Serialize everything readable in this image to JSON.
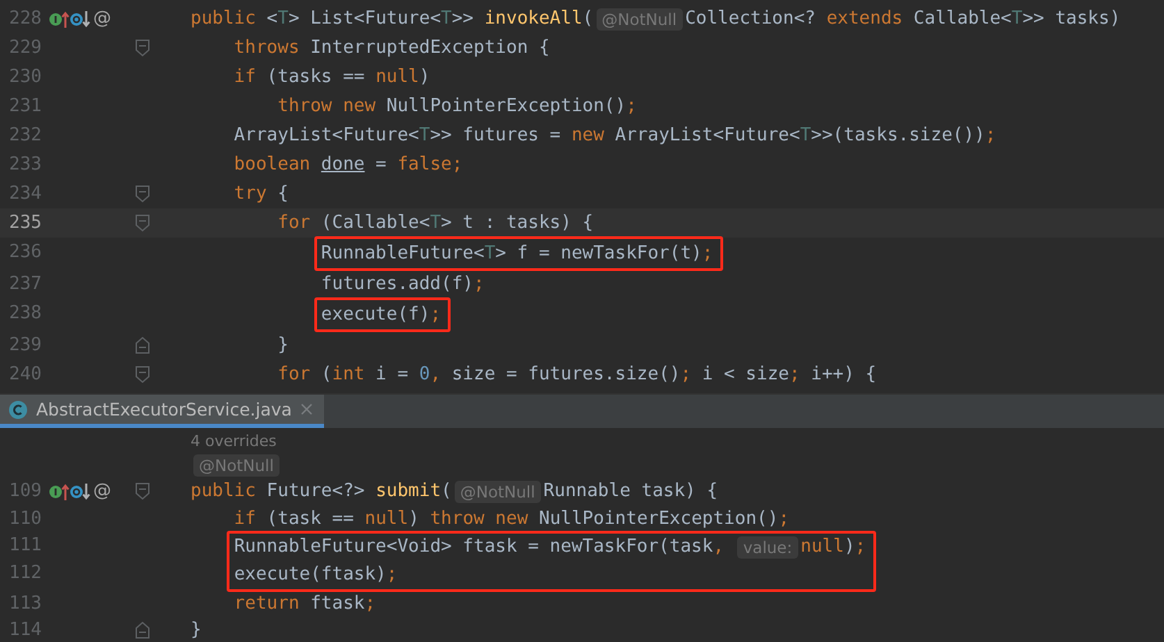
{
  "editor_top": {
    "lines": [
      {
        "number": "228",
        "gutter_mark": "@",
        "current": false,
        "boxed": false,
        "fold_start": false,
        "fold_end": false,
        "tokens": [
          {
            "text": "public",
            "kind": "keyword"
          },
          {
            "text": " <",
            "kind": "plain"
          },
          {
            "text": "T",
            "kind": "type_param"
          },
          {
            "text": "> List<Future<",
            "kind": "plain"
          },
          {
            "text": "T",
            "kind": "type_param"
          },
          {
            "text": ">> ",
            "kind": "plain"
          },
          {
            "text": "invokeAll",
            "kind": "method"
          },
          {
            "text": "(",
            "kind": "plain"
          },
          {
            "text": "@NotNull",
            "kind": "inlay"
          },
          {
            "text": "Collection<? ",
            "kind": "plain"
          },
          {
            "text": "extends",
            "kind": "keyword"
          },
          {
            "text": " Callable<",
            "kind": "plain"
          },
          {
            "text": "T",
            "kind": "type_param"
          },
          {
            "text": ">> tasks)",
            "kind": "plain"
          }
        ]
      },
      {
        "number": "229",
        "current": false,
        "boxed": false,
        "fold_start": true,
        "fold_end": false,
        "tokens": [
          {
            "text": "    throws",
            "kind": "keyword"
          },
          {
            "text": " InterruptedException {",
            "kind": "plain"
          }
        ]
      },
      {
        "number": "230",
        "current": false,
        "boxed": false,
        "fold_start": false,
        "fold_end": false,
        "tokens": [
          {
            "text": "    if",
            "kind": "keyword"
          },
          {
            "text": " (tasks == ",
            "kind": "plain"
          },
          {
            "text": "null",
            "kind": "keyword"
          },
          {
            "text": ")",
            "kind": "plain"
          }
        ]
      },
      {
        "number": "231",
        "current": false,
        "boxed": false,
        "fold_start": false,
        "fold_end": false,
        "tokens": [
          {
            "text": "        throw new",
            "kind": "keyword"
          },
          {
            "text": " NullPointerException()",
            "kind": "plain"
          },
          {
            "text": ";",
            "kind": "keyword"
          }
        ]
      },
      {
        "number": "232",
        "current": false,
        "boxed": false,
        "fold_start": false,
        "fold_end": false,
        "tokens": [
          {
            "text": "    ArrayList<Future<",
            "kind": "plain"
          },
          {
            "text": "T",
            "kind": "type_param"
          },
          {
            "text": ">> futures = ",
            "kind": "plain"
          },
          {
            "text": "new",
            "kind": "keyword"
          },
          {
            "text": " ArrayList<Future<",
            "kind": "plain"
          },
          {
            "text": "T",
            "kind": "type_param"
          },
          {
            "text": ">>(tasks.size())",
            "kind": "plain"
          },
          {
            "text": ";",
            "kind": "keyword"
          }
        ]
      },
      {
        "number": "233",
        "current": false,
        "boxed": false,
        "fold_start": false,
        "fold_end": false,
        "tokens": [
          {
            "text": "    boolean ",
            "kind": "keyword"
          },
          {
            "text": "done",
            "kind": "local_var"
          },
          {
            "text": " = ",
            "kind": "plain"
          },
          {
            "text": "false;",
            "kind": "keyword"
          }
        ]
      },
      {
        "number": "234",
        "current": false,
        "boxed": false,
        "fold_start": true,
        "fold_end": false,
        "tokens": [
          {
            "text": "    try",
            "kind": "keyword"
          },
          {
            "text": " {",
            "kind": "plain"
          }
        ]
      },
      {
        "number": "235",
        "current": true,
        "boxed": false,
        "fold_start": true,
        "fold_end": false,
        "tokens": [
          {
            "text": "        for",
            "kind": "keyword"
          },
          {
            "text": " (Callable<",
            "kind": "plain"
          },
          {
            "text": "T",
            "kind": "type_param"
          },
          {
            "text": "> t : tasks) {",
            "kind": "plain"
          }
        ]
      },
      {
        "number": "236",
        "current": false,
        "boxed": true,
        "fold_start": false,
        "fold_end": false,
        "tokens": [
          {
            "text": "            RunnableFuture<",
            "kind": "plain"
          },
          {
            "text": "T",
            "kind": "type_param"
          },
          {
            "text": "> f = newTaskFor(t)",
            "kind": "plain"
          },
          {
            "text": ";",
            "kind": "keyword"
          }
        ]
      },
      {
        "number": "237",
        "current": false,
        "boxed": false,
        "fold_start": false,
        "fold_end": false,
        "tokens": [
          {
            "text": "            futures.add(f)",
            "kind": "plain"
          },
          {
            "text": ";",
            "kind": "keyword"
          }
        ]
      },
      {
        "number": "238",
        "current": false,
        "boxed": true,
        "fold_start": false,
        "fold_end": false,
        "tokens": [
          {
            "text": "            execute(f)",
            "kind": "plain"
          },
          {
            "text": ";",
            "kind": "keyword"
          }
        ]
      },
      {
        "number": "239",
        "current": false,
        "boxed": false,
        "fold_start": false,
        "fold_end": true,
        "tokens": [
          {
            "text": "        }",
            "kind": "plain"
          }
        ]
      },
      {
        "number": "240",
        "current": false,
        "boxed": false,
        "fold_start": true,
        "fold_end": false,
        "tokens": [
          {
            "text": "        for",
            "kind": "keyword"
          },
          {
            "text": " (",
            "kind": "plain"
          },
          {
            "text": "int",
            "kind": "keyword"
          },
          {
            "text": " i = ",
            "kind": "plain"
          },
          {
            "text": "0",
            "kind": "number"
          },
          {
            "text": ",",
            "kind": "keyword"
          },
          {
            "text": " size = futures.size()",
            "kind": "plain"
          },
          {
            "text": ";",
            "kind": "keyword"
          },
          {
            "text": " i < size",
            "kind": "plain"
          },
          {
            "text": ";",
            "kind": "keyword"
          },
          {
            "text": " i++) {",
            "kind": "plain"
          }
        ]
      }
    ]
  },
  "tab_bar": {
    "tabs": [
      {
        "label": "AbstractExecutorService.java",
        "selected": true
      }
    ]
  },
  "editor_bottom": {
    "lines": [
      {
        "current": false,
        "boxed": false,
        "fold_start": false,
        "fold_end": false,
        "tokens": [
          {
            "text": "4 overrides",
            "kind": "hint"
          }
        ]
      },
      {
        "current": false,
        "boxed": false,
        "fold_start": false,
        "fold_end": false,
        "tokens": [
          {
            "text": "@NotNull",
            "kind": "inlay"
          }
        ]
      },
      {
        "number": "109",
        "gutter_mark": "@",
        "current": false,
        "boxed": false,
        "fold_start": true,
        "fold_end": false,
        "tokens": [
          {
            "text": "public",
            "kind": "keyword"
          },
          {
            "text": " Future<?> ",
            "kind": "plain"
          },
          {
            "text": "submit",
            "kind": "method"
          },
          {
            "text": "(",
            "kind": "plain"
          },
          {
            "text": "@NotNull",
            "kind": "inlay"
          },
          {
            "text": "Runnable task) {",
            "kind": "plain"
          }
        ]
      },
      {
        "number": "110",
        "current": false,
        "boxed": false,
        "fold_start": false,
        "fold_end": false,
        "tokens": [
          {
            "text": "    if",
            "kind": "keyword"
          },
          {
            "text": " (task == ",
            "kind": "plain"
          },
          {
            "text": "null",
            "kind": "keyword"
          },
          {
            "text": ") ",
            "kind": "plain"
          },
          {
            "text": "throw new",
            "kind": "keyword"
          },
          {
            "text": " NullPointerException()",
            "kind": "plain"
          },
          {
            "text": ";",
            "kind": "keyword"
          }
        ]
      },
      {
        "number": "111",
        "current": false,
        "boxed": true,
        "fold_start": false,
        "fold_end": false,
        "tokens": [
          {
            "text": "    RunnableFuture<Void> ftask = newTaskFor(task",
            "kind": "plain"
          },
          {
            "text": ", ",
            "kind": "keyword"
          },
          {
            "text": "value:",
            "kind": "inlay"
          },
          {
            "text": "null",
            "kind": "keyword"
          },
          {
            "text": ")",
            "kind": "plain"
          },
          {
            "text": ";",
            "kind": "keyword"
          }
        ]
      },
      {
        "number": "112",
        "current": false,
        "boxed": true,
        "fold_start": false,
        "fold_end": false,
        "tokens": [
          {
            "text": "    execute(ftask)",
            "kind": "plain"
          },
          {
            "text": ";",
            "kind": "keyword"
          }
        ]
      },
      {
        "number": "113",
        "current": false,
        "boxed": false,
        "fold_start": false,
        "fold_end": false,
        "tokens": [
          {
            "text": "    return",
            "kind": "keyword"
          },
          {
            "text": " ftask",
            "kind": "plain"
          },
          {
            "text": ";",
            "kind": "keyword"
          }
        ]
      },
      {
        "number": "114",
        "current": false,
        "boxed": false,
        "fold_start": false,
        "fold_end": true,
        "tokens": [
          {
            "text": "}",
            "kind": "plain"
          }
        ]
      }
    ]
  }
}
